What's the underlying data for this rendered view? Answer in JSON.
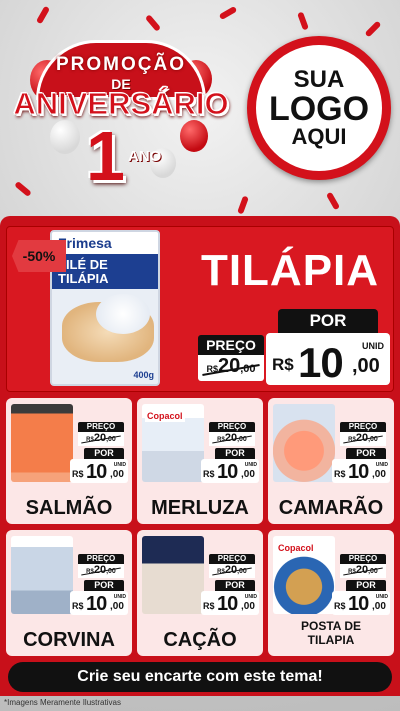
{
  "header": {
    "promo_label": "PROMOÇÃO",
    "de_label": "DE",
    "aniversario_label": "ANIVERSÁRIO",
    "number": "1",
    "ano_label": "ANO",
    "logo_line1": "SUA",
    "logo_line2": "LOGO",
    "logo_line3": "AQUI"
  },
  "hero": {
    "discount_badge": "-50%",
    "pack_brand": "Frimesa",
    "pack_title_line1": "FILÉ DE",
    "pack_title_line2": "TILÁPIA",
    "pack_weight": "400g",
    "product_name": "TILÁPIA",
    "preco_label": "PREÇO",
    "old_currency": "R$",
    "old_int": "20",
    "old_dec": ",00",
    "por_label": "POR",
    "new_currency": "R$",
    "new_int": "10",
    "new_dec": ",00",
    "unit_label": "UNID"
  },
  "products": [
    {
      "name": "SALMÃO",
      "preco_label": "PREÇO",
      "old_currency": "R$",
      "old_int": "20",
      "old_dec": ",00",
      "por_label": "POR",
      "new_currency": "R$",
      "new_int": "10",
      "new_dec": ",00",
      "unit_label": "UNID"
    },
    {
      "name": "MERLUZA",
      "brand": "Copacol",
      "preco_label": "PREÇO",
      "old_currency": "R$",
      "old_int": "20",
      "old_dec": ",00",
      "por_label": "POR",
      "new_currency": "R$",
      "new_int": "10",
      "new_dec": ",00",
      "unit_label": "UNID"
    },
    {
      "name": "CAMARÃO",
      "preco_label": "PREÇO",
      "old_currency": "R$",
      "old_int": "20",
      "old_dec": ",00",
      "por_label": "POR",
      "new_currency": "R$",
      "new_int": "10",
      "new_dec": ",00",
      "unit_label": "UNID"
    },
    {
      "name": "CORVINA",
      "preco_label": "PREÇO",
      "old_currency": "R$",
      "old_int": "20",
      "old_dec": ",00",
      "por_label": "POR",
      "new_currency": "R$",
      "new_int": "10",
      "new_dec": ",00",
      "unit_label": "UNID"
    },
    {
      "name": "CAÇÃO",
      "preco_label": "PREÇO",
      "old_currency": "R$",
      "old_int": "20",
      "old_dec": ",00",
      "por_label": "POR",
      "new_currency": "R$",
      "new_int": "10",
      "new_dec": ",00",
      "unit_label": "UNID"
    },
    {
      "name_line1": "POSTA DE",
      "name_line2": "TILAPIA",
      "brand": "Copacol",
      "preco_label": "PREÇO",
      "old_currency": "R$",
      "old_int": "20",
      "old_dec": ",00",
      "por_label": "POR",
      "new_currency": "R$",
      "new_int": "10",
      "new_dec": ",00",
      "unit_label": "UNID"
    }
  ],
  "cta_label": "Crie seu encarte com este tema!",
  "disclaimer": "*Imagens Meramente Ilustrativas",
  "colors": {
    "primary_red": "#d3111b",
    "dark": "#111111",
    "card_bg": "#fce7e7"
  }
}
